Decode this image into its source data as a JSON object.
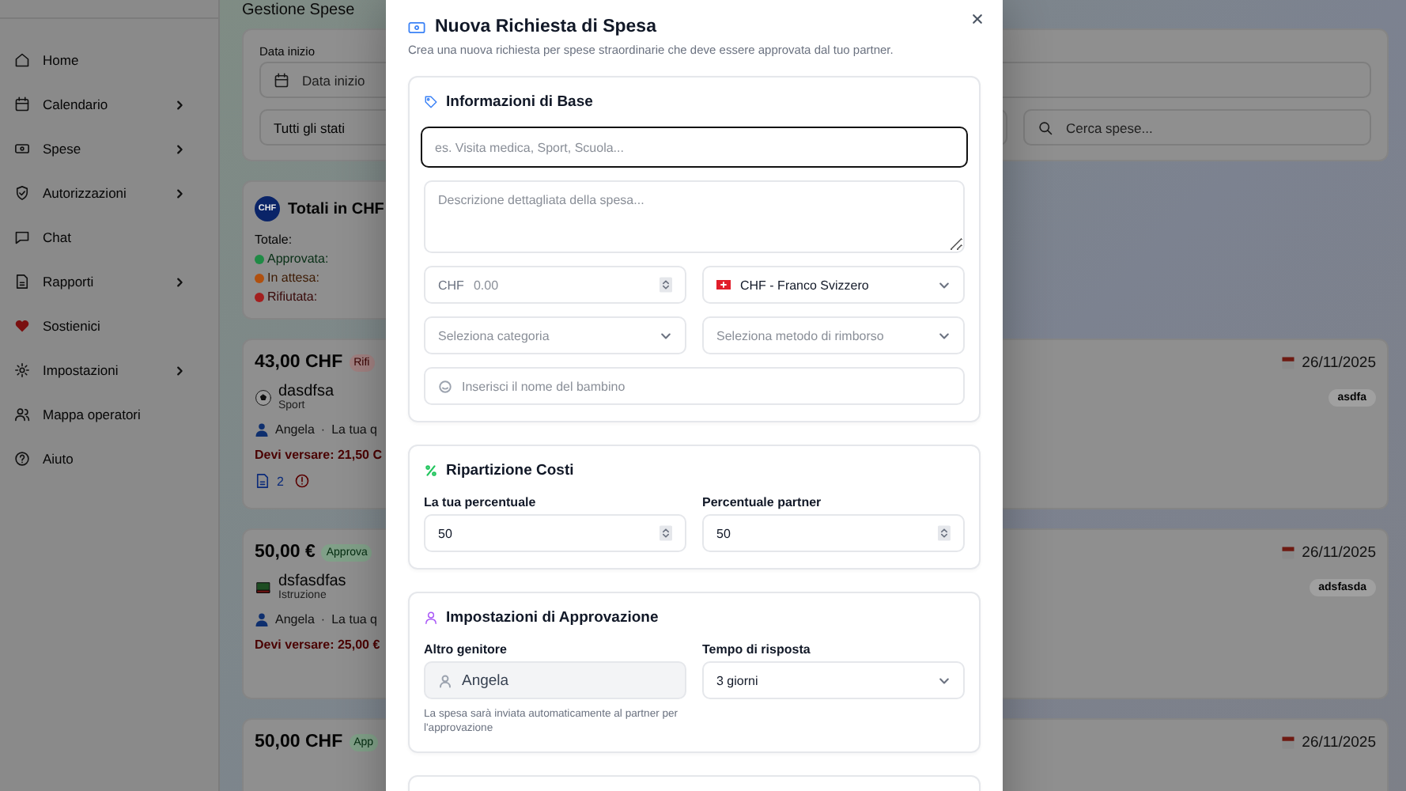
{
  "sidebar": {
    "items": [
      {
        "label": "Home",
        "has_submenu": false
      },
      {
        "label": "Calendario",
        "has_submenu": true
      },
      {
        "label": "Spese",
        "has_submenu": true
      },
      {
        "label": "Autorizzazioni",
        "has_submenu": true
      },
      {
        "label": "Chat",
        "has_submenu": false
      },
      {
        "label": "Rapporti",
        "has_submenu": true
      },
      {
        "label": "Sostienici",
        "has_submenu": false
      },
      {
        "label": "Impostazioni",
        "has_submenu": true
      },
      {
        "label": "Mappa operatori",
        "has_submenu": false
      },
      {
        "label": "Aiuto",
        "has_submenu": false
      }
    ]
  },
  "page": {
    "title": "Gestione Spese",
    "filters": {
      "date_label": "Data inizio",
      "date_placeholder": "Data inizio",
      "status_select": "Tutti gli stati",
      "search_placeholder": "Cerca spese..."
    },
    "totals": {
      "badge": "CHF",
      "title": "Totali in CHF",
      "total_label": "Totale:",
      "statuses": [
        {
          "label": "Approvata:",
          "color": "#1f8a45"
        },
        {
          "label": "In attesa:",
          "color": "#b0500f"
        },
        {
          "label": "Rifiutata:",
          "color": "#a31f1f"
        }
      ]
    },
    "expenses": [
      {
        "amount": "43,00 CHF",
        "status": "Rifi",
        "kind": "rejected",
        "title": "dasdfsa",
        "category": "Sport",
        "person": "Angela",
        "separator": "·",
        "share": "La tua q",
        "due": "Devi versare: 21,50 C",
        "attachments": "2",
        "warning": true,
        "date": "26/11/2025",
        "tag": "asdfa"
      },
      {
        "amount": "50,00 €",
        "status": "Approva",
        "kind": "approved",
        "title": "dsfasdfas",
        "category": "Istruzione",
        "person": "Angela",
        "separator": "·",
        "share": "La tua q",
        "due": "Devi versare: 25,00 €",
        "warning": false,
        "date": "26/11/2025",
        "tag": "adsfasda"
      },
      {
        "amount": "50,00 CHF",
        "status": "App",
        "kind": "approved",
        "date": "26/11/2025"
      }
    ]
  },
  "modal": {
    "title": "Nuova Richiesta di Spesa",
    "subtitle": "Crea una nuova richiesta per spese straordinarie che deve essere approvata dal tuo partner.",
    "basic": {
      "title": "Informazioni di Base",
      "title_field": {
        "placeholder": "es. Visita medica, Sport, Scuola...",
        "focused": true
      },
      "description_placeholder": "Descrizione dettagliata della spesa...",
      "currency_prefix": "CHF",
      "amount_placeholder": "0.00",
      "currency": "CHF - Franco Svizzero",
      "category_placeholder": "Seleziona categoria",
      "method_placeholder": "Seleziona metodo di rimborso",
      "child_placeholder": "Inserisci il nome del bambino"
    },
    "split": {
      "title": "Ripartizione Costi",
      "your_label": "La tua percentuale",
      "your_value": "50",
      "partner_label": "Percentuale partner",
      "partner_value": "50"
    },
    "approval": {
      "title": "Impostazioni di Approvazione",
      "parent_label": "Altro genitore",
      "parent_value": "Angela",
      "parent_help": "La spesa sarà inviata automaticamente al partner per l'approvazione",
      "time_label": "Tempo di risposta",
      "time_value": "3 giorni"
    }
  }
}
